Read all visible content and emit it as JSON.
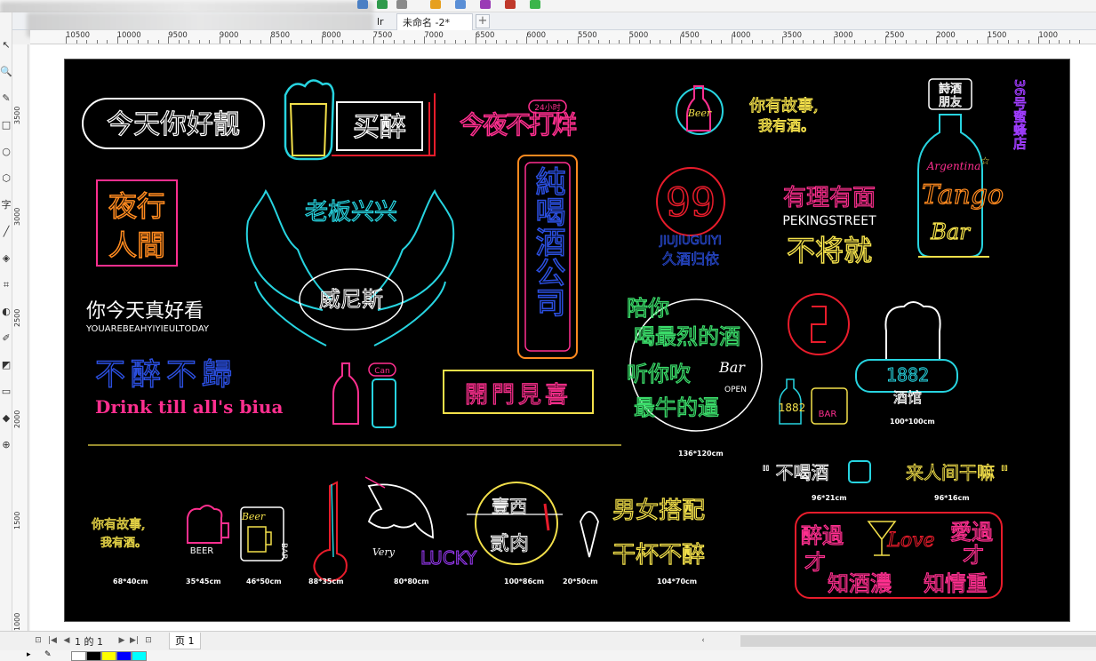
{
  "tabs": {
    "partial_label": "lr",
    "active_label": "未命名 -2*",
    "add_label": "+"
  },
  "ruler": {
    "h_labels": [
      "10500",
      "10000",
      "9500",
      "9000",
      "8500",
      "8000",
      "7500",
      "7000",
      "6500",
      "6000",
      "5500",
      "5000",
      "4500",
      "4000",
      "3500",
      "3000",
      "2500",
      "2000",
      "1500",
      "1000"
    ],
    "v_labels": [
      "3500",
      "3000",
      "2500",
      "2000",
      "1500",
      "1000"
    ]
  },
  "toolbox": {
    "tools": [
      "pick-tool",
      "zoom-tool",
      "freehand-tool",
      "rectangle-tool",
      "ellipse-tool",
      "polygon-tool",
      "text-tool",
      "line-tool",
      "fill-tool",
      "crop-tool",
      "transparency-tool",
      "eyedropper-tool",
      "interactive-fill-tool",
      "outline-tool",
      "smart-fill-tool",
      "add-icon"
    ]
  },
  "artwork": {
    "sign_1": "今天你好靓",
    "sign_2": "买醉",
    "sign_3_main": "今夜不打烊",
    "sign_3_badge": "24小时",
    "sign_4_line1": "你有故事,",
    "sign_4_line2": "我有酒。",
    "sign_5_line1": "詩酒",
    "sign_5_line2": "朋友",
    "sign_6": "36号蜜蜂店",
    "sign_7_line1": "夜行",
    "sign_7_line2": "人間",
    "sign_8_top": "老板兴兴",
    "sign_8_center": "威尼斯",
    "sign_9": "純喝酒公司",
    "sign_10_logo": "99",
    "sign_10_en": "JIUJIUGUIYI",
    "sign_10_cn": "久酒归依",
    "sign_11_line1": "有理有面",
    "sign_11_line2": "PEKINGSTREET",
    "sign_11_line3": "不将就",
    "sign_12_a": "Argentina",
    "sign_12_b": "Tango",
    "sign_12_c": "Bar",
    "sign_13_cn": "你今天真好看",
    "sign_13_en": "YOUAREBEAHYIYIEULTODAY",
    "sign_14_cn": "不醉不歸",
    "sign_14_en": "Drink till all's biua",
    "sign_15_line1": "陪你",
    "sign_15_line2": "喝最烈的酒",
    "sign_15_line3": "听你吹",
    "sign_15_line4": "最牛的逼",
    "sign_15_bar": "Bar",
    "sign_15_open": "OPEN",
    "sign_15_size": "136*120cm",
    "sign_16": "開門見喜",
    "sign_17_num": "1882",
    "sign_17_cn": "酒馆",
    "sign_17_size": "100*100cm",
    "sign_18_num": "1882",
    "sign_18_bar": "BAR",
    "sign_19": "\" 不喝酒",
    "sign_19_size": "96*21cm",
    "sign_20": "来人间干嘛 \"",
    "sign_20_size": "96*16cm",
    "sign_21_line1": "醉過",
    "sign_21_line2": "才",
    "sign_21_line3": "知酒濃",
    "sign_21_love": "Love",
    "sign_21_r1": "愛過",
    "sign_21_r2": "才",
    "sign_21_r3": "知情重",
    "can_label": "Can",
    "beer_label": "Beer",
    "bottom_1_line1": "你有故事,",
    "bottom_1_line2": "我有酒。",
    "bottom_1_size": "68*40cm",
    "bottom_2_label": "BEER",
    "bottom_2_size": "35*45cm",
    "bottom_3_label": "Beer",
    "bottom_3_bar": "BAR",
    "bottom_3_size": "46*50cm",
    "bottom_4_size": "88*35cm",
    "bottom_5_lucky": "LUCKY",
    "bottom_5_very": "Very",
    "bottom_5_size": "80*80cm",
    "bottom_6_line1": "壹西",
    "bottom_6_line2": "贰肉",
    "bottom_6_size": "100*86cm",
    "bottom_7_size": "20*50cm",
    "bottom_8_line1": "男女搭配",
    "bottom_8_line2": "干杯不醉",
    "bottom_8_size": "104*70cm"
  },
  "bottombar": {
    "page_of": "1 的 1",
    "page_tab": "页 1"
  },
  "colors": {
    "white": "#ffffff",
    "cyan": "#27d4e0",
    "pink": "#ff2f8f",
    "yellow": "#f3e04a",
    "orange": "#ff8a1f",
    "red": "#e81c2b",
    "blue": "#2b4fe0",
    "purple": "#a03cff",
    "green": "#3bdc6a"
  }
}
